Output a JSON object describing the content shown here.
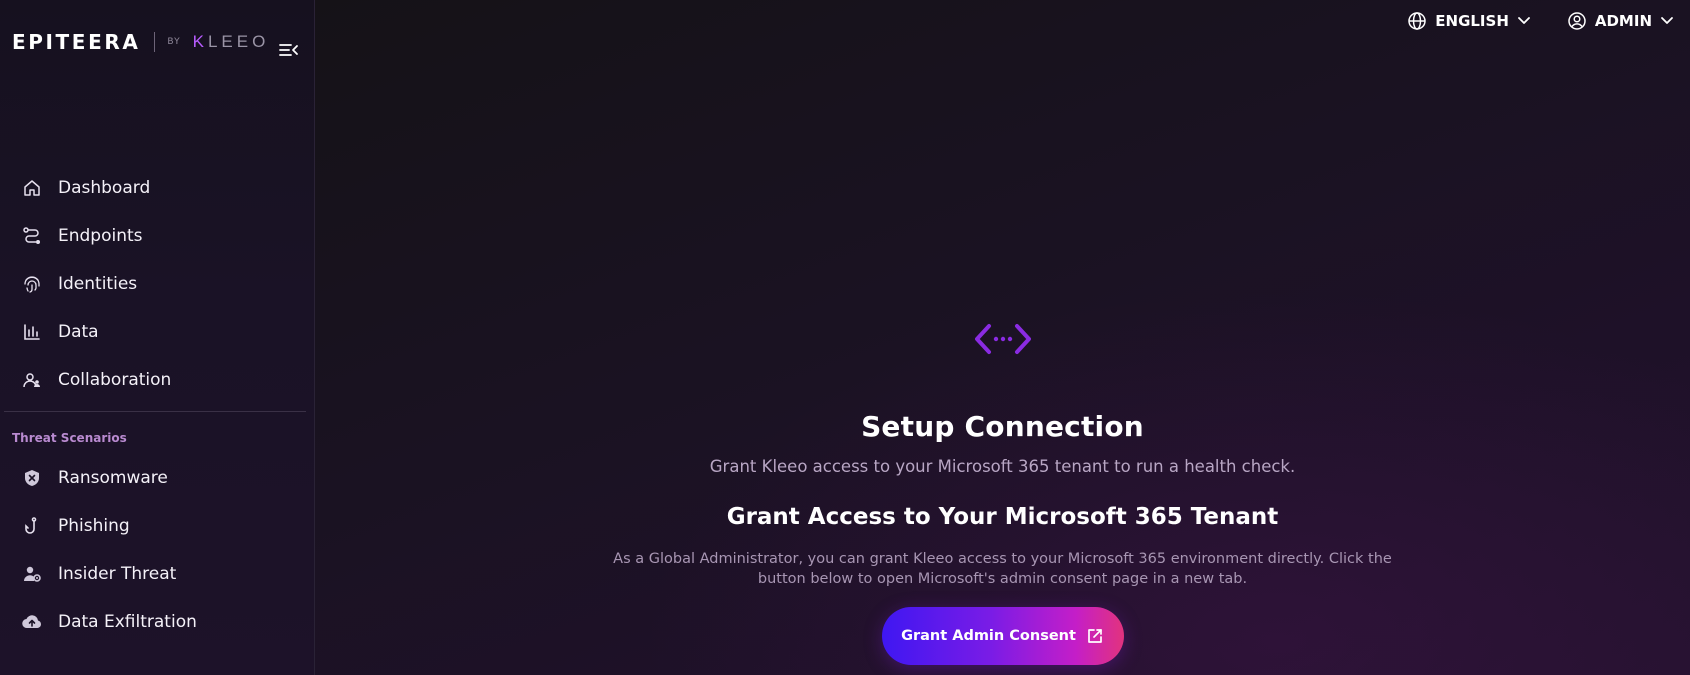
{
  "brand": {
    "name": "EPITEERA",
    "by": "BY",
    "partner_k": "K",
    "partner_rest": "LEEO"
  },
  "sidebar": {
    "main_items": [
      {
        "label": "Dashboard",
        "icon": "home-icon"
      },
      {
        "label": "Endpoints",
        "icon": "route-icon"
      },
      {
        "label": "Identities",
        "icon": "fingerprint-icon"
      },
      {
        "label": "Data",
        "icon": "bar-chart-icon"
      },
      {
        "label": "Collaboration",
        "icon": "user-group-icon"
      }
    ],
    "section_title": "Threat Scenarios",
    "threat_items": [
      {
        "label": "Ransomware",
        "icon": "shield-x-icon"
      },
      {
        "label": "Phishing",
        "icon": "fishhook-icon"
      },
      {
        "label": "Insider Threat",
        "icon": "user-gear-icon"
      },
      {
        "label": "Data Exfiltration",
        "icon": "cloud-upload-icon"
      }
    ]
  },
  "topbar": {
    "language": "ENGLISH",
    "user": "ADMIN"
  },
  "content": {
    "icon": "connection-icon",
    "title": "Setup Connection",
    "subtitle": "Grant Kleeo access to your Microsoft 365 tenant to run a health check.",
    "title2": "Grant Access to Your Microsoft 365 Tenant",
    "description": "As a Global Administrator, you can grant Kleeo access to your Microsoft 365 environment directly. Click the button below to open Microsoft's admin consent page in a new tab.",
    "cta_label": "Grant Admin Consent"
  },
  "colors": {
    "accent_purple": "#8a2be2",
    "section_title": "#b98ad0",
    "cta_start": "#3f17f2",
    "cta_end": "#e2337e"
  }
}
